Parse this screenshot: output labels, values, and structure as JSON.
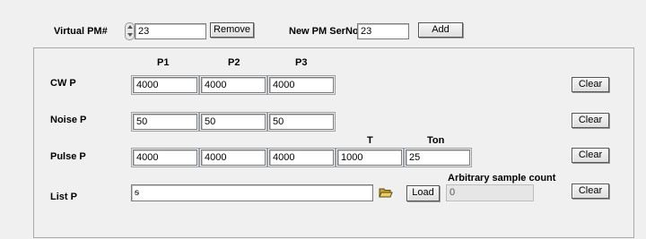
{
  "top": {
    "virtual_pm_label": "Virtual PM#",
    "virtual_pm_value": "23",
    "remove_label": "Remove",
    "new_pm_label": "New PM SerNo",
    "new_pm_value": "23",
    "add_label": "Add"
  },
  "columns": {
    "p1": "P1",
    "p2": "P2",
    "p3": "P3",
    "t": "T",
    "ton": "Ton"
  },
  "rows": {
    "cw": {
      "label": "CW P",
      "p1": "4000",
      "p2": "4000",
      "p3": "4000",
      "clear": "Clear"
    },
    "noise": {
      "label": "Noise P",
      "p1": "50",
      "p2": "50",
      "p3": "50",
      "clear": "Clear"
    },
    "pulse": {
      "label": "Pulse P",
      "p1": "4000",
      "p2": "4000",
      "p3": "4000",
      "t": "1000",
      "ton": "25",
      "clear": "Clear"
    },
    "list": {
      "label": "List P",
      "path_glyph": "ᵴ",
      "load": "Load",
      "arb_label": "Arbitrary sample count",
      "arb_value": "0",
      "clear": "Clear"
    }
  },
  "icons": {
    "spinner": "increment-decrement-icon",
    "browse": "folder-open-icon"
  }
}
